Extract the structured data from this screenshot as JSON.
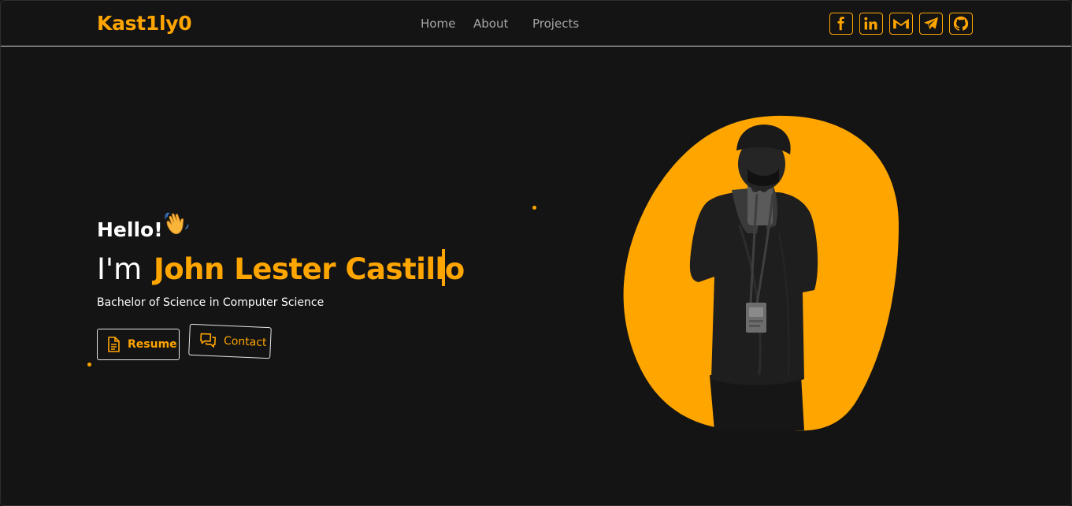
{
  "header": {
    "brand": "Kast1ly0",
    "nav": [
      {
        "label": "Home"
      },
      {
        "label": "About"
      },
      {
        "label": "Projects"
      }
    ],
    "socials": [
      {
        "icon": "facebook-icon"
      },
      {
        "icon": "linkedin-icon"
      },
      {
        "icon": "gmail-icon"
      },
      {
        "icon": "telegram-icon"
      },
      {
        "icon": "github-icon"
      }
    ]
  },
  "hero": {
    "greeting": "Hello!",
    "greeting_emoji": "waving-hand-icon",
    "intro": "I'm",
    "name": "John Lester Castillo",
    "subtitle": "Bachelor of Science in Computer Science",
    "resume_label": "Resume",
    "contact_label": "Contact"
  },
  "colors": {
    "accent": "#ffa500",
    "background": "#141414",
    "nav_text": "#a7a7a7",
    "text": "#ffffff"
  }
}
